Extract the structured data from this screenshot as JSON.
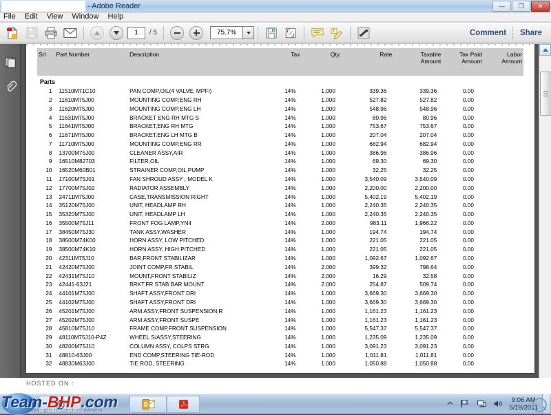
{
  "window": {
    "title_suffix": "- Adobe Reader",
    "filename_redacted": "",
    "minimize_glyph": "—",
    "maximize_glyph": "❐",
    "close_glyph": "✕"
  },
  "menu": {
    "items": [
      "File",
      "Edit",
      "View",
      "Window",
      "Help"
    ]
  },
  "toolbar": {
    "current_page": "1",
    "page_count": "/ 5",
    "zoom": "75.7%",
    "comment_label": "Comment",
    "share_label": "Share",
    "icons": [
      "create-pdf-icon",
      "save-icon",
      "print-icon",
      "email-icon",
      "previous-page-icon",
      "next-page-icon",
      "zoom-out-icon",
      "zoom-in-icon",
      "zoom-dropdown-icon",
      "save-snapshot-icon",
      "fit-page-icon",
      "sticky-note-icon",
      "highlight-text-icon",
      "read-mode-icon"
    ]
  },
  "nav_pane": {
    "icons": [
      "page-thumbnails-icon",
      "attachments-icon"
    ]
  },
  "document": {
    "columns": [
      "Srl",
      "Part Number",
      "Description",
      "Tax",
      "Qty.",
      "Rate",
      "Taxable Amount",
      "Tax Paid Amount",
      "Labor Amount"
    ],
    "columns_split": [
      {
        "l1": "Srl",
        "l2": ""
      },
      {
        "l1": "Part Number",
        "l2": ""
      },
      {
        "l1": "Description",
        "l2": ""
      },
      {
        "l1": "Tax",
        "l2": ""
      },
      {
        "l1": "Qty.",
        "l2": ""
      },
      {
        "l1": "Rate",
        "l2": ""
      },
      {
        "l1": "Taxable",
        "l2": "Amount"
      },
      {
        "l1": "Tax Paid",
        "l2": "Amount"
      },
      {
        "l1": "Labor",
        "l2": "Amount"
      }
    ],
    "group_label": "Parts",
    "rows": [
      {
        "srl": "1",
        "part": "11510M71C10",
        "desc": "PAN COMP,OIL(4 VALVE, MPFI)",
        "tax": "14%",
        "qty": "1.000",
        "rate": "339.36",
        "taxable": "339.36",
        "taxpaid": "0.00",
        "labor": ""
      },
      {
        "srl": "2",
        "part": "11610M75J00",
        "desc": "MOUNTING COMP,ENG RH",
        "tax": "14%",
        "qty": "1.000",
        "rate": "527.82",
        "taxable": "527.82",
        "taxpaid": "0.00",
        "labor": ""
      },
      {
        "srl": "3",
        "part": "11620M75J00",
        "desc": "MOUNTING COMP,ENG LH",
        "tax": "14%",
        "qty": "1.000",
        "rate": "548.96",
        "taxable": "548.96",
        "taxpaid": "0.00",
        "labor": ""
      },
      {
        "srl": "4",
        "part": "11631M75J00",
        "desc": "BRACKET ENG RH MTG S",
        "tax": "14%",
        "qty": "1.000",
        "rate": "80.96",
        "taxable": "80.96",
        "taxpaid": "0.00",
        "labor": ""
      },
      {
        "srl": "5",
        "part": "11641M75J00",
        "desc": "BRACKET,ENG RH MTG",
        "tax": "14%",
        "qty": "1.000",
        "rate": "753.67",
        "taxable": "753.67",
        "taxpaid": "0.00",
        "labor": ""
      },
      {
        "srl": "6",
        "part": "11671M75J00",
        "desc": "BRACKET,ENG LH MTG B",
        "tax": "14%",
        "qty": "1.000",
        "rate": "207.04",
        "taxable": "207.04",
        "taxpaid": "0.00",
        "labor": ""
      },
      {
        "srl": "7",
        "part": "11710M75J00",
        "desc": "MOUNTING COMP,ENG RR",
        "tax": "14%",
        "qty": "1.000",
        "rate": "682.94",
        "taxable": "682.94",
        "taxpaid": "0.00",
        "labor": ""
      },
      {
        "srl": "8",
        "part": "13700M75J00",
        "desc": "CLEANER ASSY,AIR",
        "tax": "14%",
        "qty": "1.000",
        "rate": "386.96",
        "taxable": "386.96",
        "taxpaid": "0.00",
        "labor": ""
      },
      {
        "srl": "9",
        "part": "16510M82703",
        "desc": "FILTER,OIL",
        "tax": "14%",
        "qty": "1.000",
        "rate": "69.30",
        "taxable": "69.30",
        "taxpaid": "0.00",
        "labor": ""
      },
      {
        "srl": "10",
        "part": "16520M60B01",
        "desc": "STRAINER COMP,OIL PUMP",
        "tax": "14%",
        "qty": "1.000",
        "rate": "32.25",
        "taxable": "32.25",
        "taxpaid": "0.00",
        "labor": ""
      },
      {
        "srl": "11",
        "part": "17100M75J01",
        "desc": "FAN SHROUD ASSY , MODEL K",
        "tax": "14%",
        "qty": "1.000",
        "rate": "3,540.09",
        "taxable": "3,540.09",
        "taxpaid": "0.00",
        "labor": ""
      },
      {
        "srl": "12",
        "part": "17700M75J02",
        "desc": "RADIATOR ASSEMBLY",
        "tax": "14%",
        "qty": "1.000",
        "rate": "2,200.00",
        "taxable": "2,200.00",
        "taxpaid": "0.00",
        "labor": ""
      },
      {
        "srl": "13",
        "part": "24711M75J00",
        "desc": "CASE,TRANSMISSION RIGHT",
        "tax": "14%",
        "qty": "1.000",
        "rate": "5,402.19",
        "taxable": "5,402.19",
        "taxpaid": "0.00",
        "labor": ""
      },
      {
        "srl": "14",
        "part": "35120M75J00",
        "desc": "UNIT, HEADLAMP RH",
        "tax": "14%",
        "qty": "1.000",
        "rate": "2,240.35",
        "taxable": "2,240.35",
        "taxpaid": "0.00",
        "labor": ""
      },
      {
        "srl": "15",
        "part": "35320M75J00",
        "desc": "UNIT, HEADLAMP LH",
        "tax": "14%",
        "qty": "1.000",
        "rate": "2,240.35",
        "taxable": "2,240.35",
        "taxpaid": "0.00",
        "labor": ""
      },
      {
        "srl": "16",
        "part": "35500M75J11",
        "desc": "FRONT FOG LAMP,YN4",
        "tax": "14%",
        "qty": "2.000",
        "rate": "983.11",
        "taxable": "1,966.22",
        "taxpaid": "0.00",
        "labor": ""
      },
      {
        "srl": "17",
        "part": "38450M75J30",
        "desc": "TANK ASSY,WASHER",
        "tax": "14%",
        "qty": "1.000",
        "rate": "194.74",
        "taxable": "194.74",
        "taxpaid": "0.00",
        "labor": ""
      },
      {
        "srl": "18",
        "part": "38500M74K00",
        "desc": "HORN ASSY, LOW PITCHED",
        "tax": "14%",
        "qty": "1.000",
        "rate": "221.05",
        "taxable": "221.05",
        "taxpaid": "0.00",
        "labor": ""
      },
      {
        "srl": "19",
        "part": "38500M74K10",
        "desc": "HORN ASSY, HIGH PITCHED",
        "tax": "14%",
        "qty": "1.000",
        "rate": "221.05",
        "taxable": "221.05",
        "taxpaid": "0.00",
        "labor": ""
      },
      {
        "srl": "20",
        "part": "42311M75J10",
        "desc": "BAR,FRONT STABILIZAR",
        "tax": "14%",
        "qty": "1.000",
        "rate": "1,092.67",
        "taxable": "1,092.67",
        "taxpaid": "0.00",
        "labor": ""
      },
      {
        "srl": "21",
        "part": "42420M75J00",
        "desc": "JOINT COMP,FR STABIL",
        "tax": "14%",
        "qty": "2.000",
        "rate": "399.32",
        "taxable": "798.64",
        "taxpaid": "0.00",
        "labor": ""
      },
      {
        "srl": "22",
        "part": "42431M75J10",
        "desc": "MOUNT,FRONT STABILIZ",
        "tax": "14%",
        "qty": "2.000",
        "rate": "16.29",
        "taxable": "32.58",
        "taxpaid": "0.00",
        "labor": ""
      },
      {
        "srl": "23",
        "part": "42441-63J21",
        "desc": "BRKT,FR STAB BAR MOUNT",
        "tax": "14%",
        "qty": "2.000",
        "rate": "254.87",
        "taxable": "509.74",
        "taxpaid": "0.00",
        "labor": ""
      },
      {
        "srl": "24",
        "part": "44101M75J00",
        "desc": "SHAFT ASSY,FRONT DRI",
        "tax": "14%",
        "qty": "1.000",
        "rate": "3,669.30",
        "taxable": "3,669.30",
        "taxpaid": "0.00",
        "labor": ""
      },
      {
        "srl": "25",
        "part": "44102M75J00",
        "desc": "SHAFT ASSY,FRONT DRI",
        "tax": "14%",
        "qty": "1.000",
        "rate": "3,669.30",
        "taxable": "3,669.30",
        "taxpaid": "0.00",
        "labor": ""
      },
      {
        "srl": "26",
        "part": "45201M75J00",
        "desc": "ARM ASSY,FRONT SUSPENSION,R",
        "tax": "14%",
        "qty": "1.000",
        "rate": "1,161.23",
        "taxable": "1,161.23",
        "taxpaid": "0.00",
        "labor": ""
      },
      {
        "srl": "27",
        "part": "45202M75J00",
        "desc": "ARM ASSY,FRONT SUSPE",
        "tax": "14%",
        "qty": "1.000",
        "rate": "1,161.23",
        "taxable": "1,161.23",
        "taxpaid": "0.00",
        "labor": ""
      },
      {
        "srl": "28",
        "part": "45810M75J10",
        "desc": "FRAME COMP,FRONT SUSPENSION",
        "tax": "14%",
        "qty": "1.000",
        "rate": "5,547.37",
        "taxable": "5,547.37",
        "taxpaid": "0.00",
        "labor": ""
      },
      {
        "srl": "29",
        "part": "48110M75J10-P4Z",
        "desc": "WHEEL S/ASSY,STEERING",
        "tax": "14%",
        "qty": "1.000",
        "rate": "1,235.09",
        "taxable": "1,235.09",
        "taxpaid": "0.00",
        "labor": ""
      },
      {
        "srl": "30",
        "part": "48200M75J10",
        "desc": "COLUMN ASSY, COLPS STRG",
        "tax": "14%",
        "qty": "1.000",
        "rate": "3,091.23",
        "taxable": "3,091.23",
        "taxpaid": "0.00",
        "labor": ""
      },
      {
        "srl": "31",
        "part": "48810-63J00",
        "desc": "END COMP,STEERING TIE-ROD",
        "tax": "14%",
        "qty": "1.000",
        "rate": "1,011.81",
        "taxable": "1,011.81",
        "taxpaid": "0.00",
        "labor": ""
      },
      {
        "srl": "32",
        "part": "48830M63J00",
        "desc": "TIE ROD, STEERING",
        "tax": "14%",
        "qty": "1.000",
        "rate": "1,050.88",
        "taxable": "1,050.88",
        "taxpaid": "0.00",
        "labor": ""
      }
    ]
  },
  "overlay": {
    "hosted_label": "HOSTED ON :",
    "watermark_part1": "Team-",
    "watermark_part2": "BHP",
    "watermark_part3": ".com",
    "watermark_sub": "copyright respective owners"
  },
  "taskbar": {
    "buttons": [
      "internet-explorer-taskbar-button",
      "outlook-taskbar-button",
      "adobe-reader-taskbar-button"
    ],
    "tray_icons": [
      "show-hidden-icons",
      "action-flag-icon",
      "network-icon",
      "volume-icon"
    ],
    "time": "9:06 AM",
    "date": "5/19/2011"
  },
  "colors": {
    "accent": "#2a4f76",
    "table_header_bg": "#cccccc",
    "doc_bg": "#535353",
    "watermark_blue": "#1b3f8b",
    "watermark_red": "#c62222"
  }
}
